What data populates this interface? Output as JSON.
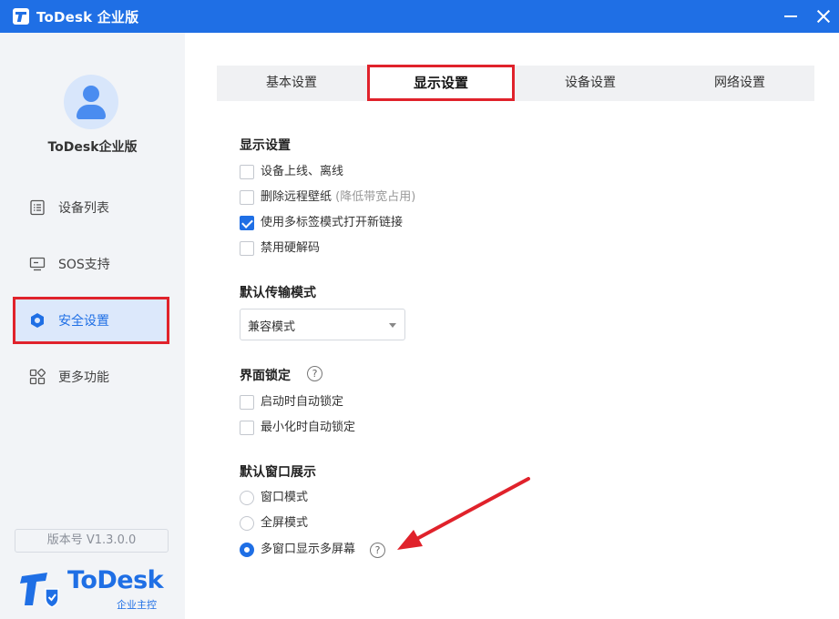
{
  "window": {
    "title": "ToDesk 企业版"
  },
  "sidebar": {
    "user_name": "ToDesk企业版",
    "items": [
      {
        "label": "设备列表",
        "icon": "list-icon"
      },
      {
        "label": "SOS支持",
        "icon": "monitor-icon"
      },
      {
        "label": "安全设置",
        "icon": "hexagon-icon",
        "selected": true
      },
      {
        "label": "更多功能",
        "icon": "grid-icon"
      }
    ],
    "version": "版本号 V1.3.0.0",
    "brand": {
      "name": "ToDesk",
      "subtitle": "企业主控"
    }
  },
  "tabs": [
    {
      "label": "基本设置"
    },
    {
      "label": "显示设置",
      "active": true
    },
    {
      "label": "设备设置"
    },
    {
      "label": "网络设置"
    }
  ],
  "display": {
    "title": "显示设置",
    "options": [
      {
        "label": "设备上线、离线",
        "checked": false
      },
      {
        "label": "删除远程壁纸",
        "note": "(降低带宽占用)",
        "checked": false
      },
      {
        "label": "使用多标签模式打开新链接",
        "checked": true
      },
      {
        "label": "禁用硬解码",
        "checked": false
      }
    ]
  },
  "transfer": {
    "title": "默认传输模式",
    "selected": "兼容模式"
  },
  "lock": {
    "title": "界面锁定",
    "help": "?",
    "options": [
      {
        "label": "启动时自动锁定",
        "checked": false
      },
      {
        "label": "最小化时自动锁定",
        "checked": false
      }
    ]
  },
  "window_mode": {
    "title": "默认窗口展示",
    "help": "?",
    "options": [
      {
        "label": "窗口模式",
        "checked": false
      },
      {
        "label": "全屏模式",
        "checked": false
      },
      {
        "label": "多窗口显示多屏幕",
        "checked": true
      }
    ]
  },
  "colors": {
    "accent": "#1f6fe5",
    "highlight": "#e0222b"
  }
}
